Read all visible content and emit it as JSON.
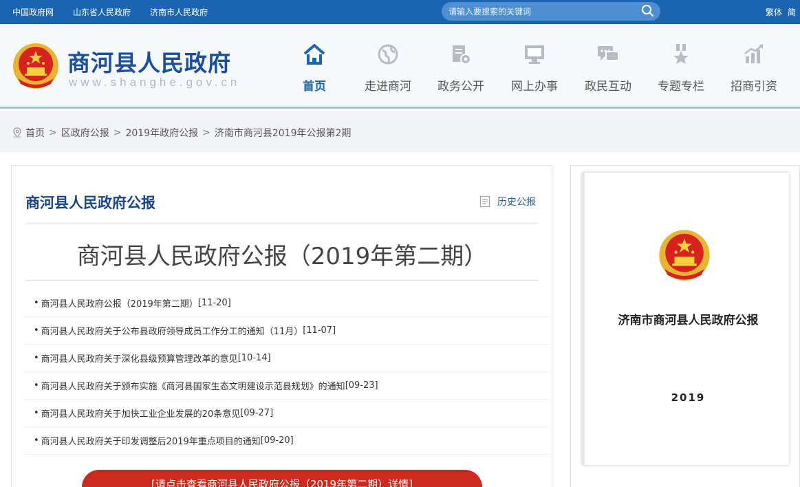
{
  "topbar": {
    "links": [
      "中国政府网",
      "山东省人民政府",
      "济南市人民政府"
    ],
    "search_placeholder": "请输入要搜索的关键词",
    "lang_traditional": "繁体",
    "lang_simplified": "简"
  },
  "header": {
    "site_title": "商河县人民政府",
    "site_url": "www.shanghe.gov.cn",
    "nav": [
      {
        "label": "首页",
        "icon": "home-icon",
        "active": true
      },
      {
        "label": "走进商河",
        "icon": "globe-icon"
      },
      {
        "label": "政务公开",
        "icon": "document-settings-icon"
      },
      {
        "label": "网上办事",
        "icon": "monitor-icon"
      },
      {
        "label": "政民互动",
        "icon": "chat-icon"
      },
      {
        "label": "专题专栏",
        "icon": "medal-icon"
      },
      {
        "label": "招商引资",
        "icon": "growth-chart-icon"
      }
    ]
  },
  "breadcrumb": {
    "items": [
      "首页",
      "区政府公报",
      "2019年政府公报",
      "济南市商河县2019年公报第2期"
    ],
    "separator": ">"
  },
  "main": {
    "panel_title": "商河县人民政府公报",
    "history_link": "历史公报",
    "issue_title": "商河县人民政府公报（2019年第二期）",
    "bullet": "•",
    "documents": [
      {
        "title": "商河县人民政府公报（2019年第二期）",
        "date": "[11-20]"
      },
      {
        "title": "商河县人民政府关于公布县政府领导成员工作分工的通知（11月）",
        "date": "[11-07]"
      },
      {
        "title": "商河县人民政府关于深化县级预算管理改革的意见",
        "date": "[10-14]"
      },
      {
        "title": "商河县人民政府关于颁布实施《商河县国家生态文明建设示范县规划》的通知",
        "date": "[09-23]"
      },
      {
        "title": "商河县人民政府关于加快工业企业发展的20条意见",
        "date": "[09-27]"
      },
      {
        "title": "商河县人民政府关于印发调整后2019年重点项目的通知",
        "date": "[09-20]"
      }
    ],
    "detail_button": "[请点击查看商河县人民政府公报（2019年第二期）详情]"
  },
  "side": {
    "cover_title": "济南市商河县人民政府公报",
    "cover_year": "2019"
  },
  "colors": {
    "topbar": "#1a64b1",
    "title_blue": "#17458c",
    "button_red": "#cc2a1f"
  }
}
